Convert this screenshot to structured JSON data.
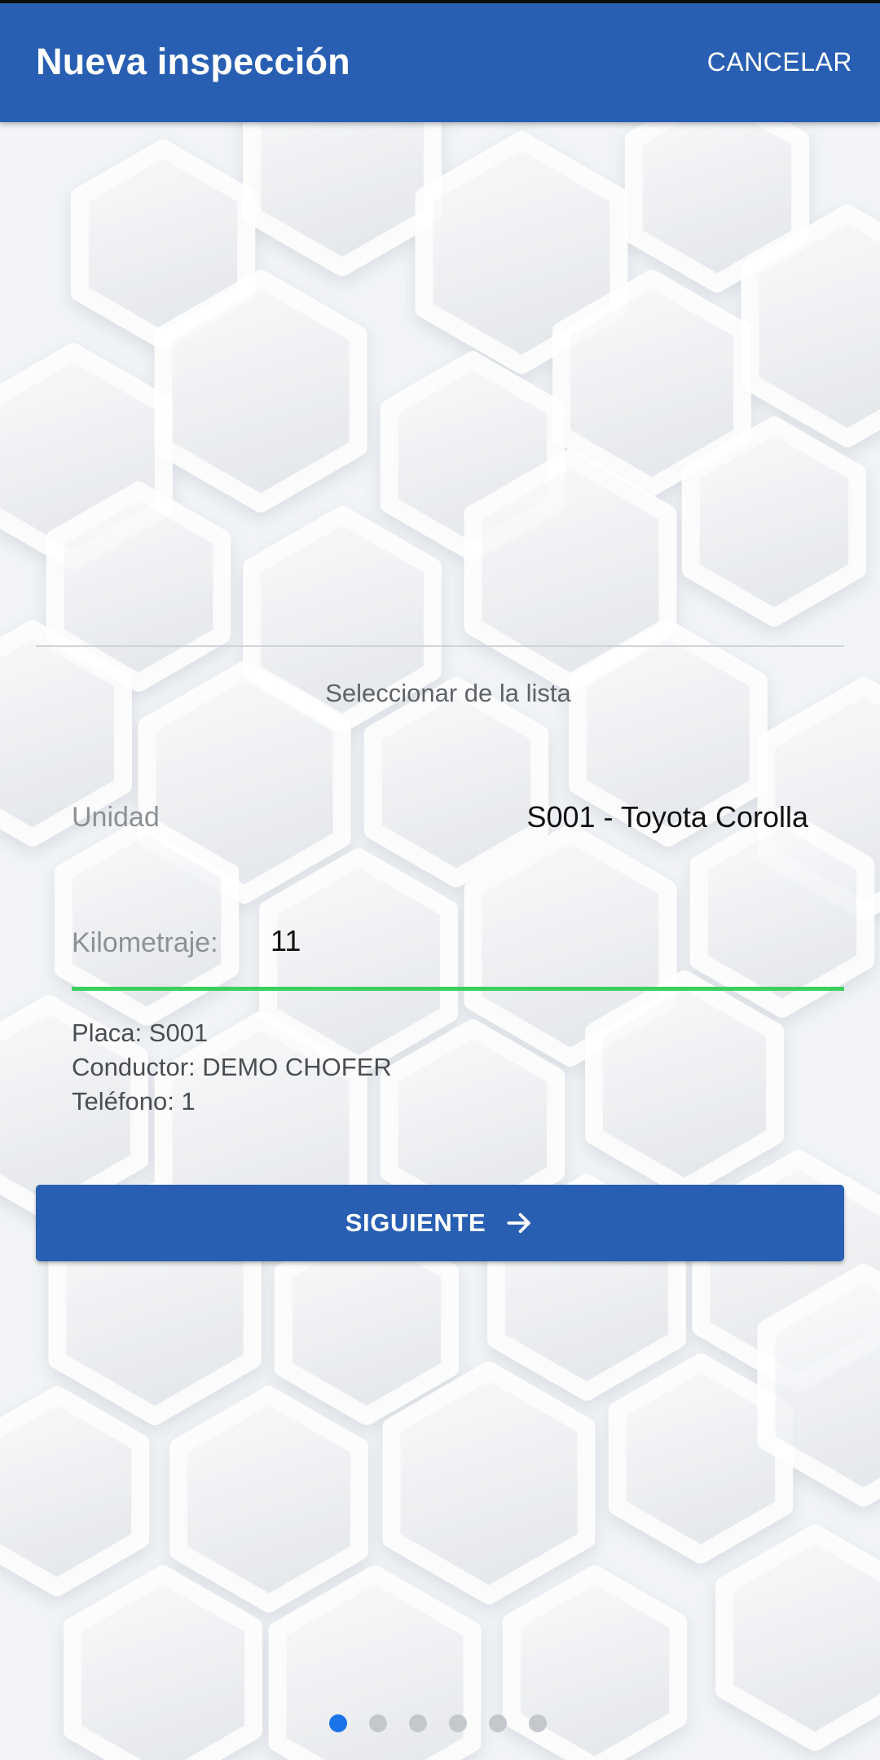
{
  "app_bar": {
    "title": "Nueva inspección",
    "cancel_label": "CANCELAR",
    "color": "#285fb3"
  },
  "form": {
    "select_from_list": "Seleccionar de la lista",
    "unit_label": "Unidad",
    "unit_value": "S001 - Toyota Corolla",
    "mileage_label": "Kilometraje:",
    "mileage_value": "11",
    "mileage_underline_color": "#3ccf5f"
  },
  "details": {
    "plate": "Placa: S001",
    "driver": "Conductor: DEMO CHOFER",
    "phone": "Teléfono: 1"
  },
  "next_button": {
    "label": "SIGUIENTE",
    "icon": "arrow-right-icon"
  },
  "pager": {
    "total_steps": 6,
    "current_step": 1,
    "active_color": "#1a73e8"
  }
}
